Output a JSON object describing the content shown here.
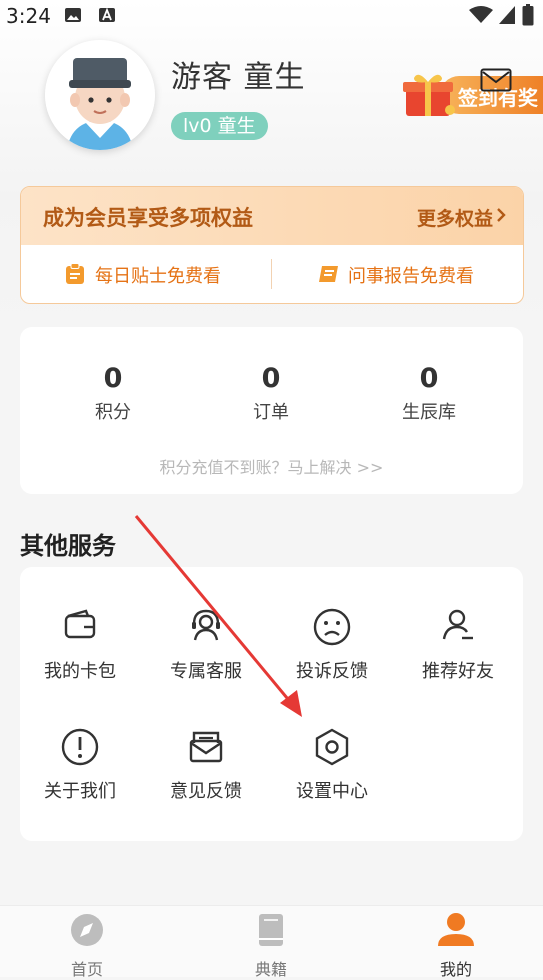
{
  "status_bar": {
    "time": "3:24"
  },
  "profile": {
    "name": "游客 童生",
    "level": "lv0 童生"
  },
  "sign_in": {
    "label": "签到有奖"
  },
  "vip": {
    "title": "成为会员享受多项权益",
    "more": "更多权益",
    "items": [
      {
        "label": "每日贴士免费看",
        "icon": "clipboard-icon"
      },
      {
        "label": "问事报告免费看",
        "icon": "scroll-icon"
      }
    ]
  },
  "stats": {
    "items": [
      {
        "value": "0",
        "label": "积分"
      },
      {
        "value": "0",
        "label": "订单"
      },
      {
        "value": "0",
        "label": "生辰库"
      }
    ],
    "tip": "积分充值不到账？马上解决 >>"
  },
  "services": {
    "title": "其他服务",
    "items": [
      {
        "label": "我的卡包",
        "icon": "wallet-icon"
      },
      {
        "label": "专属客服",
        "icon": "headset-icon"
      },
      {
        "label": "投诉反馈",
        "icon": "sad-face-icon"
      },
      {
        "label": "推荐好友",
        "icon": "user-share-icon"
      },
      {
        "label": "关于我们",
        "icon": "info-icon"
      },
      {
        "label": "意见反馈",
        "icon": "mail-icon"
      },
      {
        "label": "设置中心",
        "icon": "settings-icon"
      }
    ]
  },
  "tabbar": {
    "tabs": [
      {
        "label": "首页",
        "icon": "compass-icon"
      },
      {
        "label": "典籍",
        "icon": "book-icon"
      },
      {
        "label": "我的",
        "icon": "person-icon"
      }
    ],
    "active_index": 2,
    "accent": "#f07a22"
  },
  "colors": {
    "accent_orange": "#e57316",
    "level_badge": "#7fd0bd",
    "arrow": "#e53935"
  }
}
